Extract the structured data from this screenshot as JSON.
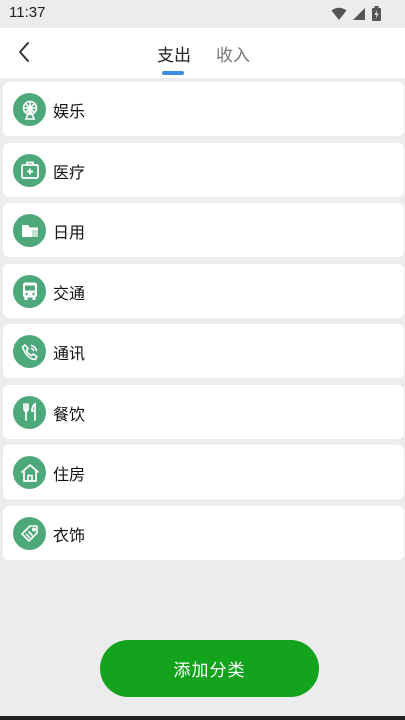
{
  "status_bar": {
    "time": "11:37",
    "icons": [
      "wifi-icon",
      "signal-icon",
      "battery-charging-icon"
    ]
  },
  "header": {
    "back_icon": "chevron-left-icon",
    "tabs": [
      {
        "label": "支出",
        "active": true
      },
      {
        "label": "收入",
        "active": false
      }
    ],
    "accent_color": "#3a8ee6"
  },
  "categories": [
    {
      "label": "娱乐",
      "icon": "ferris-wheel-icon"
    },
    {
      "label": "医疗",
      "icon": "medical-kit-icon"
    },
    {
      "label": "日用",
      "icon": "folder-icon"
    },
    {
      "label": "交通",
      "icon": "bus-icon"
    },
    {
      "label": "通讯",
      "icon": "phone-icon"
    },
    {
      "label": "餐饮",
      "icon": "fork-knife-icon"
    },
    {
      "label": "住房",
      "icon": "house-icon"
    },
    {
      "label": "衣饰",
      "icon": "tag-icon"
    }
  ],
  "icon_color": "#4ea97a",
  "add_button": {
    "label": "添加分类",
    "color": "#14a31d"
  }
}
